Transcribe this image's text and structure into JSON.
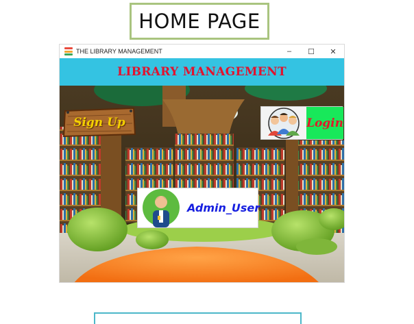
{
  "caption": {
    "text": "HOME PAGE"
  },
  "window": {
    "title": "THE LIBRARY MANAGEMENT",
    "controls": {
      "minimize": "–",
      "maximize": "☐",
      "close": "✕"
    },
    "colors": {
      "banner": "#34c3e2",
      "title_red": "#e0132f",
      "login_green": "#18e85a",
      "admin_blue": "#1720e0",
      "signup_yellow": "#f4d000"
    }
  },
  "banner": {
    "title": "LIBRARY MANAGEMENT"
  },
  "buttons": {
    "signup": {
      "label": "Sign Up",
      "icon": "wooden-sign-icon"
    },
    "login": {
      "label": "Login",
      "icon": "group-of-people-icon"
    },
    "admin": {
      "label": "Admin_User",
      "icon": "admin-person-icon"
    }
  }
}
